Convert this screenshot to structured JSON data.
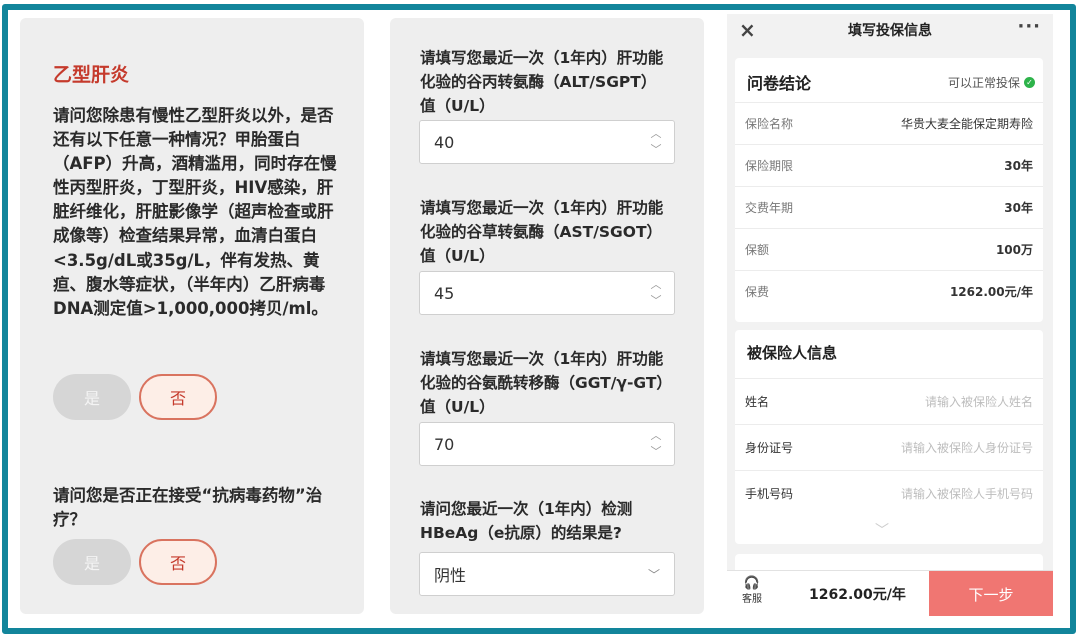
{
  "panel1": {
    "title": "乙型肝炎",
    "question1": "请问您除患有慢性乙型肝炎以外，是否还有以下任意一种情况？甲胎蛋白（AFP）升高，酒精滥用，同时存在慢性丙型肝炎，丁型肝炎，HIV感染，肝脏纤维化，肝脏影像学（超声检查或肝成像等）检查结果异常，血清白蛋白<3.5g/dL或35g/L，伴有发热、黄疸、腹水等症状，（半年内）乙肝病毒DNA测定值>1,000,000拷贝/ml。",
    "question2": "请问您是否正在接受“抗病毒药物”治疗？",
    "yes_label": "是",
    "no_label": "否"
  },
  "panel2": {
    "fields": [
      {
        "label": "请填写您最近一次（1年内）肝功能化验的谷丙转氨酶（ALT/SGPT）值（U/L）",
        "value": "40"
      },
      {
        "label": "请填写您最近一次（1年内）肝功能化验的谷草转氨酶（AST/SGOT）值（U/L）",
        "value": "45"
      },
      {
        "label": "请填写您最近一次（1年内）肝功能化验的谷氨酰转移酶（GGT/γ-GT）值（U/L）",
        "value": "70"
      }
    ],
    "hbeag_label": "请问您最近一次（1年内）检测HBeAg（e抗原）的结果是?",
    "hbeag_value": "阴性"
  },
  "panel3": {
    "nav_title": "填写投保信息",
    "close_icon": "×",
    "more_icon": "···",
    "conclusion": {
      "title": "问卷结论",
      "status": "可以正常投保",
      "status_color": "#2db34a",
      "rows": [
        {
          "key": "保险名称",
          "value": "华贵大麦全能保定期寿险"
        },
        {
          "key": "保险期限",
          "value": "30年"
        },
        {
          "key": "交费年期",
          "value": "30年"
        },
        {
          "key": "保额",
          "value": "100万"
        },
        {
          "key": "保费",
          "value": "1262.00元/年"
        }
      ]
    },
    "insured": {
      "title": "被保险人信息",
      "fields": [
        {
          "key": "姓名",
          "placeholder": "请输入被保险人姓名"
        },
        {
          "key": "身份证号",
          "placeholder": "请输入被保险人身份证号"
        },
        {
          "key": "手机号码",
          "placeholder": "请输入被保险人手机号码"
        }
      ]
    },
    "footer": {
      "service_label": "客服",
      "price": "1262.00元/年",
      "next_label": "下一步",
      "next_color": "#f07672"
    }
  }
}
